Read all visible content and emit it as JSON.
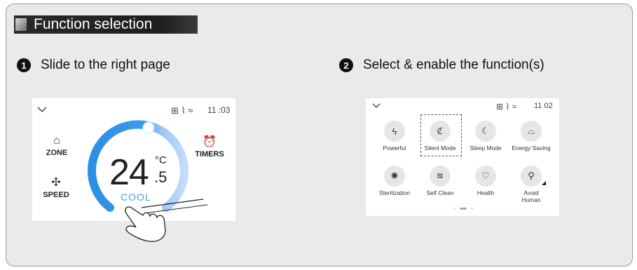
{
  "header": {
    "title": "Function selection"
  },
  "steps": [
    {
      "number": "1",
      "text": "Slide to the right page"
    },
    {
      "number": "2",
      "text": "Select & enable the function(s)"
    }
  ],
  "screen1": {
    "status_icons": "⊞ ⌇ ≈",
    "time": "11 :03",
    "zone_label": "ZONE",
    "timers_label": "TIMERS",
    "speed_label": "SPEED",
    "temp_int": "24",
    "temp_unit": "°C",
    "temp_dec": ".5",
    "mode": "COOL",
    "colors": {
      "arc_blue": "#2d8ee6",
      "arc_light": "#b8d4f8",
      "mode_text": "#4aa0e8"
    }
  },
  "screen2": {
    "status_icons": "⊞ ⌇ ≈",
    "time": "11 02",
    "functions": [
      {
        "label": "Powerful",
        "icon": "lightning-icon"
      },
      {
        "label": "Silent Mode",
        "icon": "ear-icon"
      },
      {
        "label": "Sleep Mode",
        "icon": "moon-icon"
      },
      {
        "label": "Energy Saving",
        "icon": "leaf-cup-icon"
      },
      {
        "label": "Sterilization",
        "icon": "virus-icon"
      },
      {
        "label": "Self Clean",
        "icon": "broom-icon"
      },
      {
        "label": "Health",
        "icon": "heart-plus-icon"
      },
      {
        "label": "Avoid Human",
        "icon": "person-icon"
      }
    ],
    "selected": "Silent Mode"
  }
}
